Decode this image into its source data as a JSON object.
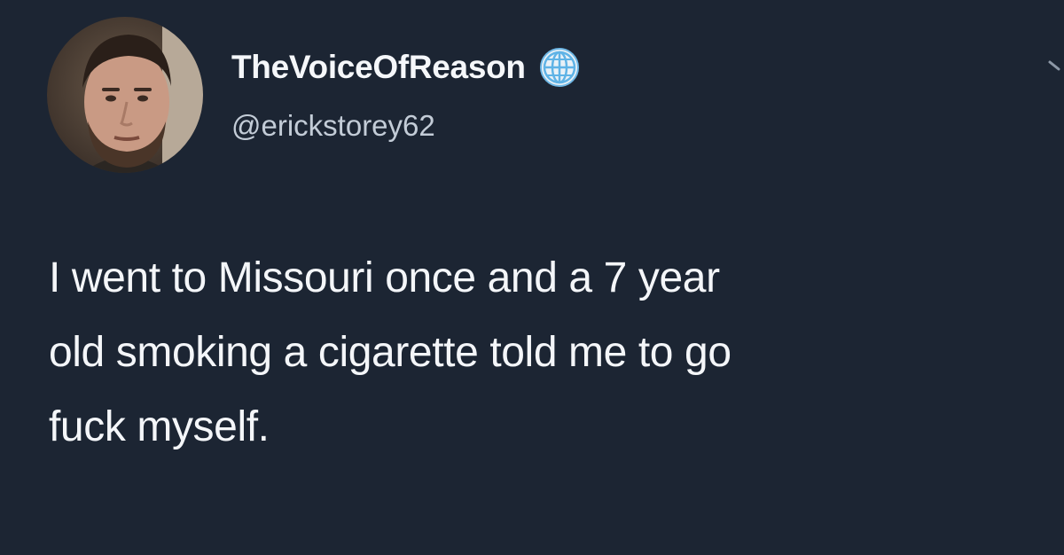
{
  "tweet": {
    "author": {
      "display_name": "TheVoiceOfReason",
      "handle": "@erickstorey62",
      "badge_icon": "globe-icon"
    },
    "text_lines": [
      "I went to Missouri once and a 7 year",
      "old smoking a cigarette told me to go",
      "fuck myself."
    ],
    "menu_icon": "chevron-down-icon"
  },
  "colors": {
    "background": "#1c2533",
    "text": "#f4f6f9",
    "handle": "#c3ccd7",
    "globe": "#5fb3e6"
  }
}
